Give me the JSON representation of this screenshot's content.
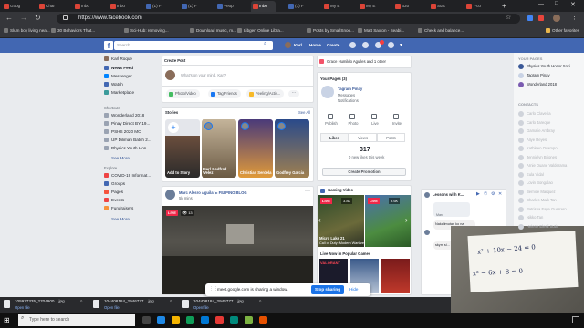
{
  "tabs": [
    {
      "label": "Goog"
    },
    {
      "label": "Char"
    },
    {
      "label": "Inbo"
    },
    {
      "label": "Inbo"
    },
    {
      "label": "(1) F"
    },
    {
      "label": "(1) F"
    },
    {
      "label": "Peop"
    },
    {
      "label": "Inbo"
    },
    {
      "label": "(1) F"
    },
    {
      "label": "My E"
    },
    {
      "label": "My E"
    },
    {
      "label": "B20"
    },
    {
      "label": "Stac"
    },
    {
      "label": "T-co"
    }
  ],
  "address": {
    "url": "https://www.facebook.com"
  },
  "bookmarks": [
    {
      "label": "Slum boy living nea..."
    },
    {
      "label": "30 Behaviors That..."
    },
    {
      "label": "Sci-Hub: removing..."
    },
    {
      "label": "Download music, m..."
    },
    {
      "label": "Libgen Online Libra..."
    },
    {
      "label": "Posts by SmallSnoo..."
    },
    {
      "label": "Matt Saxton - Seabi..."
    },
    {
      "label": "Check and balance..."
    }
  ],
  "other_bookmarks": "Other favorites",
  "fb": {
    "search_placeholder": "Search",
    "nav": {
      "user": "Karl",
      "home": "Home",
      "create": "Create"
    },
    "left": {
      "profile": "Karl Roque",
      "items": [
        "News Feed",
        "Messenger",
        "Watch",
        "Marketplace"
      ],
      "shortcuts_title": "Shortcuts",
      "shortcuts": [
        "Wonderland 2018",
        "Pinay Direct BY 19...",
        "PSHS 2020 MC",
        "UP Diliman Batch 2...",
        "Physics Youth Hon..."
      ],
      "see_more": "See More",
      "explore_title": "Explore",
      "explore": [
        "COVID-19 Informat...",
        "Groups",
        "Pages",
        "Events",
        "Fundraisers"
      ],
      "see_more2": "See More"
    },
    "create_post": {
      "title": "Create Post",
      "placeholder": "What's on your mind, Karl?",
      "actions": [
        "Photo/Video",
        "Tag Friends",
        "Feeling/Activ..."
      ]
    },
    "stories": {
      "title": "Stories",
      "see_all": "See All",
      "items": [
        "Add to Story",
        "Earl Godfred Velez",
        "Christian Serdela",
        "Godfrey Garcia"
      ]
    },
    "post": {
      "author": "Marc Alesro Aguilar ▸ FILIPINO BLOG",
      "time": "5h mins",
      "live": "LIVE",
      "views": "13"
    },
    "birthdays": "Grace Humildo Aguiles and 1 other",
    "pages": {
      "title": "Your Pages (3)",
      "page_name": "Tagram Pinay",
      "messages": "Messages",
      "notifications": "Notifications",
      "actions": [
        "Publish",
        "Photo",
        "Live",
        "Invite"
      ],
      "tabs": [
        "Likes",
        "Views",
        "Posts"
      ],
      "likes": "317",
      "likes_sub": "0 new likes this week",
      "promo": "Create Promotion"
    },
    "gaming": {
      "title": "Gaming Video",
      "live1": "LIVE",
      "count1": "3.8K",
      "live2": "LIVE",
      "count2": "9.6K",
      "game1": "Micro Lake 21",
      "game1sub": "Call of Duty: Modern Warfare",
      "live_now": "Live Now in Popular Games",
      "games": [
        "VALORANT",
        "",
        ""
      ]
    },
    "right": {
      "pages_title": "YOUR PAGES",
      "pages": [
        "Physics Youth Honor Soci...",
        "Tagram Pinay",
        "Wonderland 2018"
      ],
      "contacts_title": "CONTACTS",
      "contacts": [
        "Carlo Claveria",
        "Carlo Jareque",
        "Gamalie Ambray",
        "Aliye Reyes",
        "Kathleen Ocampo",
        "Jennielyn Briones",
        "Arnie Duane Valderama",
        "Eula Vidal",
        "Lovin Bongalao",
        "Bernice Marquez",
        "Charles Mark Tan",
        "Patrisha Faye Guerrero",
        "Nikko Tan",
        "Helene Elesii Sutio"
      ]
    },
    "chat": {
      "title": "Lessons with K...",
      "msg1": "Nakalimutan ko na",
      "msg2": "skym si...",
      "msg_label": "Marc"
    }
  },
  "share_bar": {
    "text": "meet.google.com is sharing a window.",
    "stop": "Stop sharing",
    "hide": "Hide"
  },
  "downloads": [
    {
      "name": "105977335_2704900....jpg",
      "action": "Open file"
    },
    {
      "name": "104408184_2946777....jpg",
      "action": "Open file"
    },
    {
      "name": "104408184_2946777....jpg",
      "action": "Open file"
    }
  ],
  "taskbar": {
    "search": "Type here to search"
  },
  "webcam": {
    "eq1": "x² + 10x − 24 = 0",
    "eq2": "x² − 6x + 8 = 0"
  }
}
